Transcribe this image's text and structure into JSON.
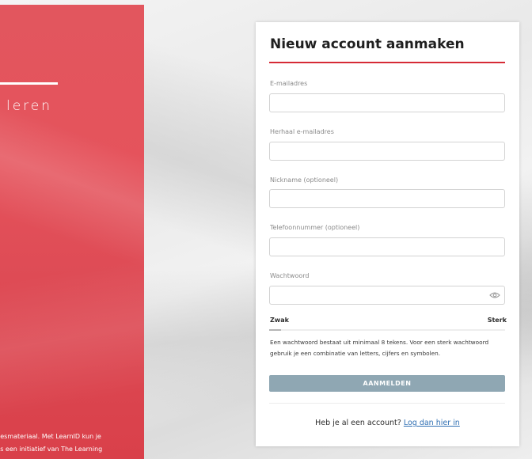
{
  "brand": {
    "name": "leren"
  },
  "footer": {
    "line1": "lesmateriaal. Met LearnID kun je",
    "line2": "is een initiatief van The Learning"
  },
  "form": {
    "title": "Nieuw account aanmaken",
    "fields": [
      {
        "label": "E-mailadres",
        "value": "",
        "placeholder": ""
      },
      {
        "label": "Herhaal e-mailadres",
        "value": "",
        "placeholder": ""
      },
      {
        "label": "Nickname (optioneel)",
        "value": "",
        "placeholder": ""
      },
      {
        "label": "Telefoonnummer (optioneel)",
        "value": "",
        "placeholder": ""
      },
      {
        "label": "Wachtwoord",
        "value": "",
        "placeholder": ""
      }
    ],
    "password_strength": {
      "weak_label": "Zwak",
      "strong_label": "Sterk",
      "level": 0.05
    },
    "hint": "Een wachtwoord bestaat uit minimaal 8 tekens. Voor een sterk wachtwoord gebruik je een combinatie van letters, cijfers en symbolen.",
    "submit_label": "AANMELDEN",
    "login_prompt": "Heb je al een account?",
    "login_link": "Log dan hier in"
  },
  "icons": {
    "password_toggle": "eye-icon"
  },
  "colors": {
    "brand_red": "#e2565e",
    "title_rule": "#d62b36",
    "button": "#8fa7b3",
    "link": "#2f6fb3"
  }
}
